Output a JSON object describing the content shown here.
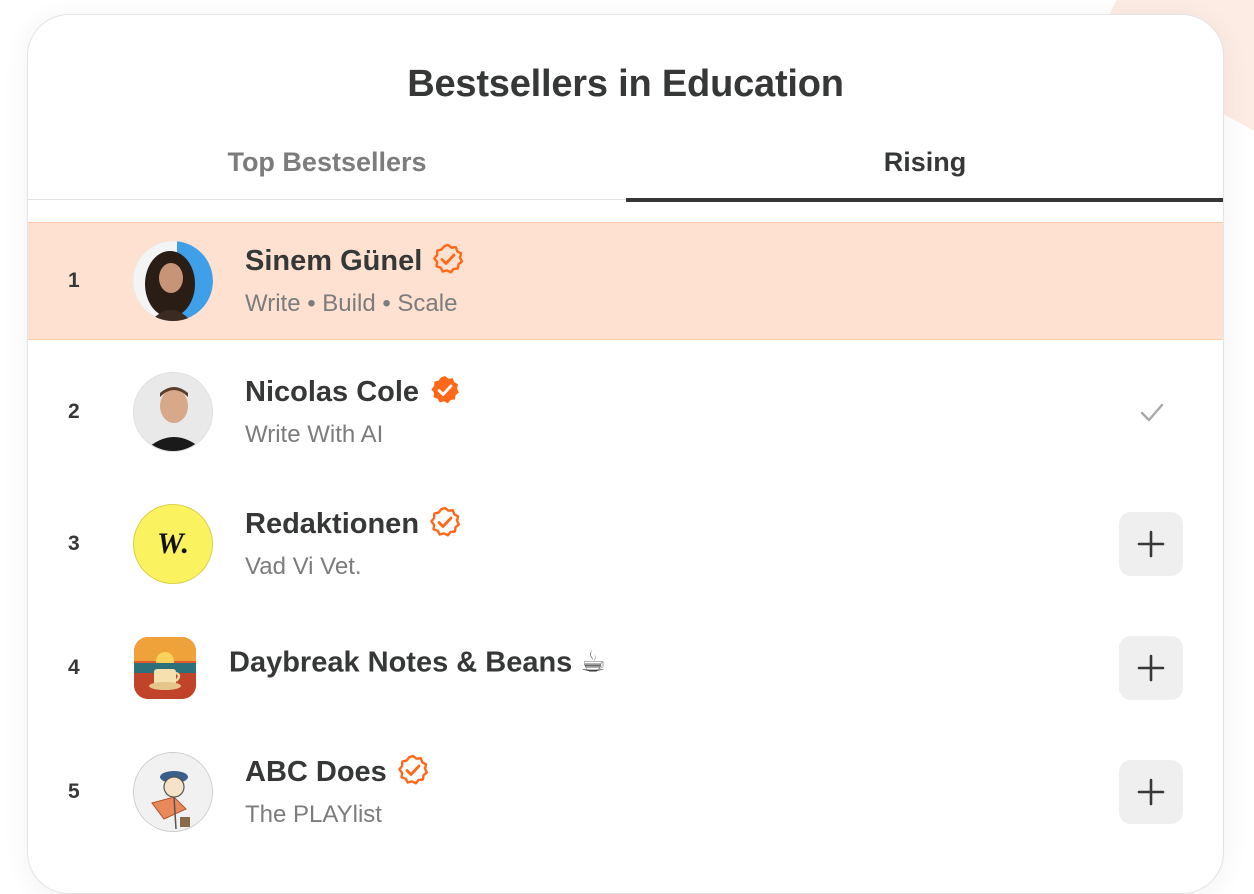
{
  "page": {
    "title": "Bestsellers in Education"
  },
  "tabs": [
    {
      "label": "Top Bestsellers",
      "active": false
    },
    {
      "label": "Rising",
      "active": true
    }
  ],
  "colors": {
    "accent": "#ff6719",
    "highlight": "#ffe1d2",
    "text": "#363737",
    "muted": "#7c7c7c"
  },
  "rows": [
    {
      "rank": "1",
      "name": "Sinem Günel",
      "subtitle": "Write • Build • Scale",
      "badge": "outline-check-badge",
      "action": "none",
      "highlighted": true
    },
    {
      "rank": "2",
      "name": "Nicolas Cole",
      "subtitle": "Write With AI",
      "badge": "filled-check-badge",
      "action": "subscribed-check"
    },
    {
      "rank": "3",
      "name": "Redaktionen",
      "subtitle": "Vad Vi Vet.",
      "badge": "outline-check-badge",
      "action": "add",
      "logo_text": "W."
    },
    {
      "rank": "4",
      "name": "Daybreak Notes & Beans ☕",
      "subtitle": "",
      "badge": "none",
      "action": "add"
    },
    {
      "rank": "5",
      "name": "ABC Does",
      "subtitle": "The PLAYlist",
      "badge": "outline-check-badge",
      "action": "add"
    }
  ]
}
